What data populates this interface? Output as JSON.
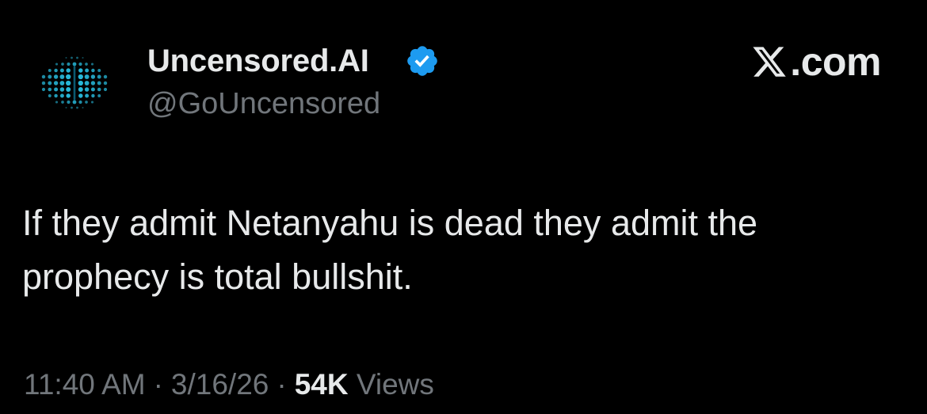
{
  "tweet": {
    "author": {
      "display_name": "Uncensored.AI",
      "handle": "@GoUncensored",
      "verified": true,
      "avatar_icon": "brain-dots-icon",
      "avatar_color": "#29c3e6",
      "verified_color": "#1d9bf0"
    },
    "text": "If they admit Netanyahu is dead they admit the prophecy is total bullshit.",
    "time": "11:40 AM",
    "separator": "·",
    "date": "3/16/26",
    "views_count": "54K",
    "views_label": "Views"
  },
  "brand": {
    "logo_icon": "x-logo-icon",
    "suffix": ".com"
  },
  "colors": {
    "background": "#000000",
    "primary_text": "#e7e9ea",
    "secondary_text": "#71767b"
  }
}
